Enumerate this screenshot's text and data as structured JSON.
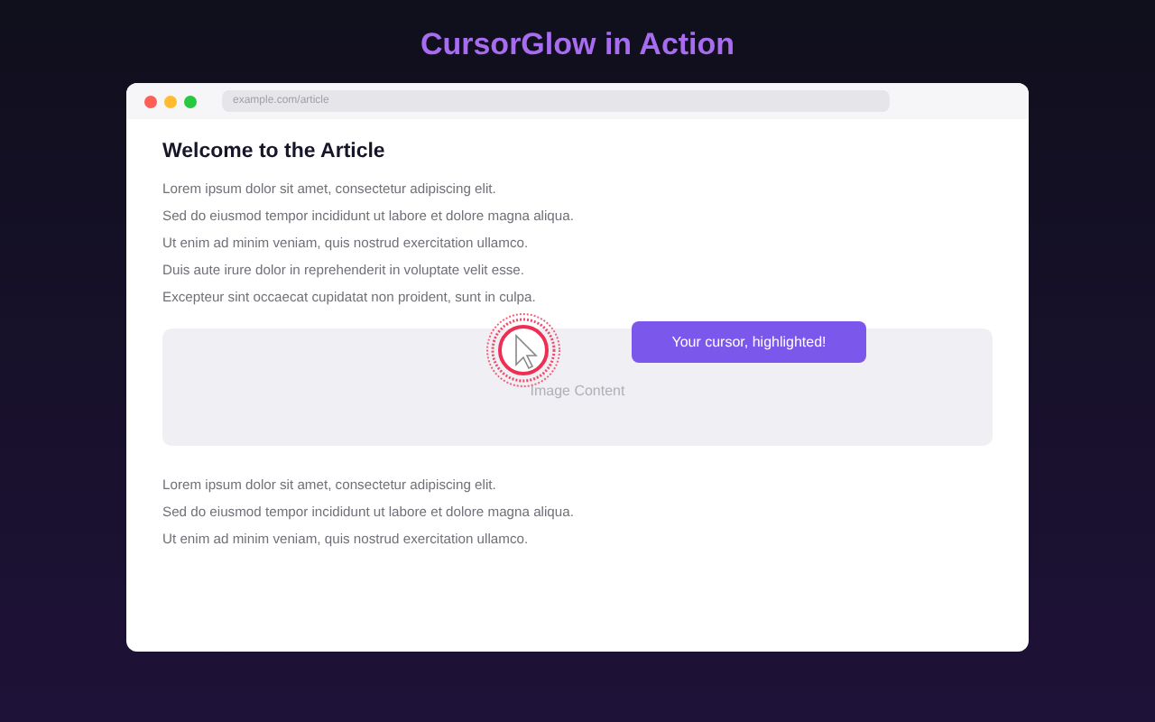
{
  "title": "CursorGlow in Action",
  "browser": {
    "address": "example.com/article"
  },
  "article": {
    "heading": "Welcome to the Article",
    "paragraphs_top": [
      "Lorem ipsum dolor sit amet, consectetur adipiscing elit.",
      "Sed do eiusmod tempor incididunt ut labore et dolore magna aliqua.",
      "Ut enim ad minim veniam, quis nostrud exercitation ullamco.",
      "Duis aute irure dolor in reprehenderit in voluptate velit esse.",
      "Excepteur sint occaecat cupidatat non proident, sunt in culpa."
    ],
    "image_placeholder": "Image Content",
    "paragraphs_bottom": [
      "Lorem ipsum dolor sit amet, consectetur adipiscing elit.",
      "Sed do eiusmod tempor incididunt ut labore et dolore magna aliqua.",
      "Ut enim ad minim veniam, quis nostrud exercitation ullamco."
    ]
  },
  "tooltip": "Your cursor, highlighted!"
}
